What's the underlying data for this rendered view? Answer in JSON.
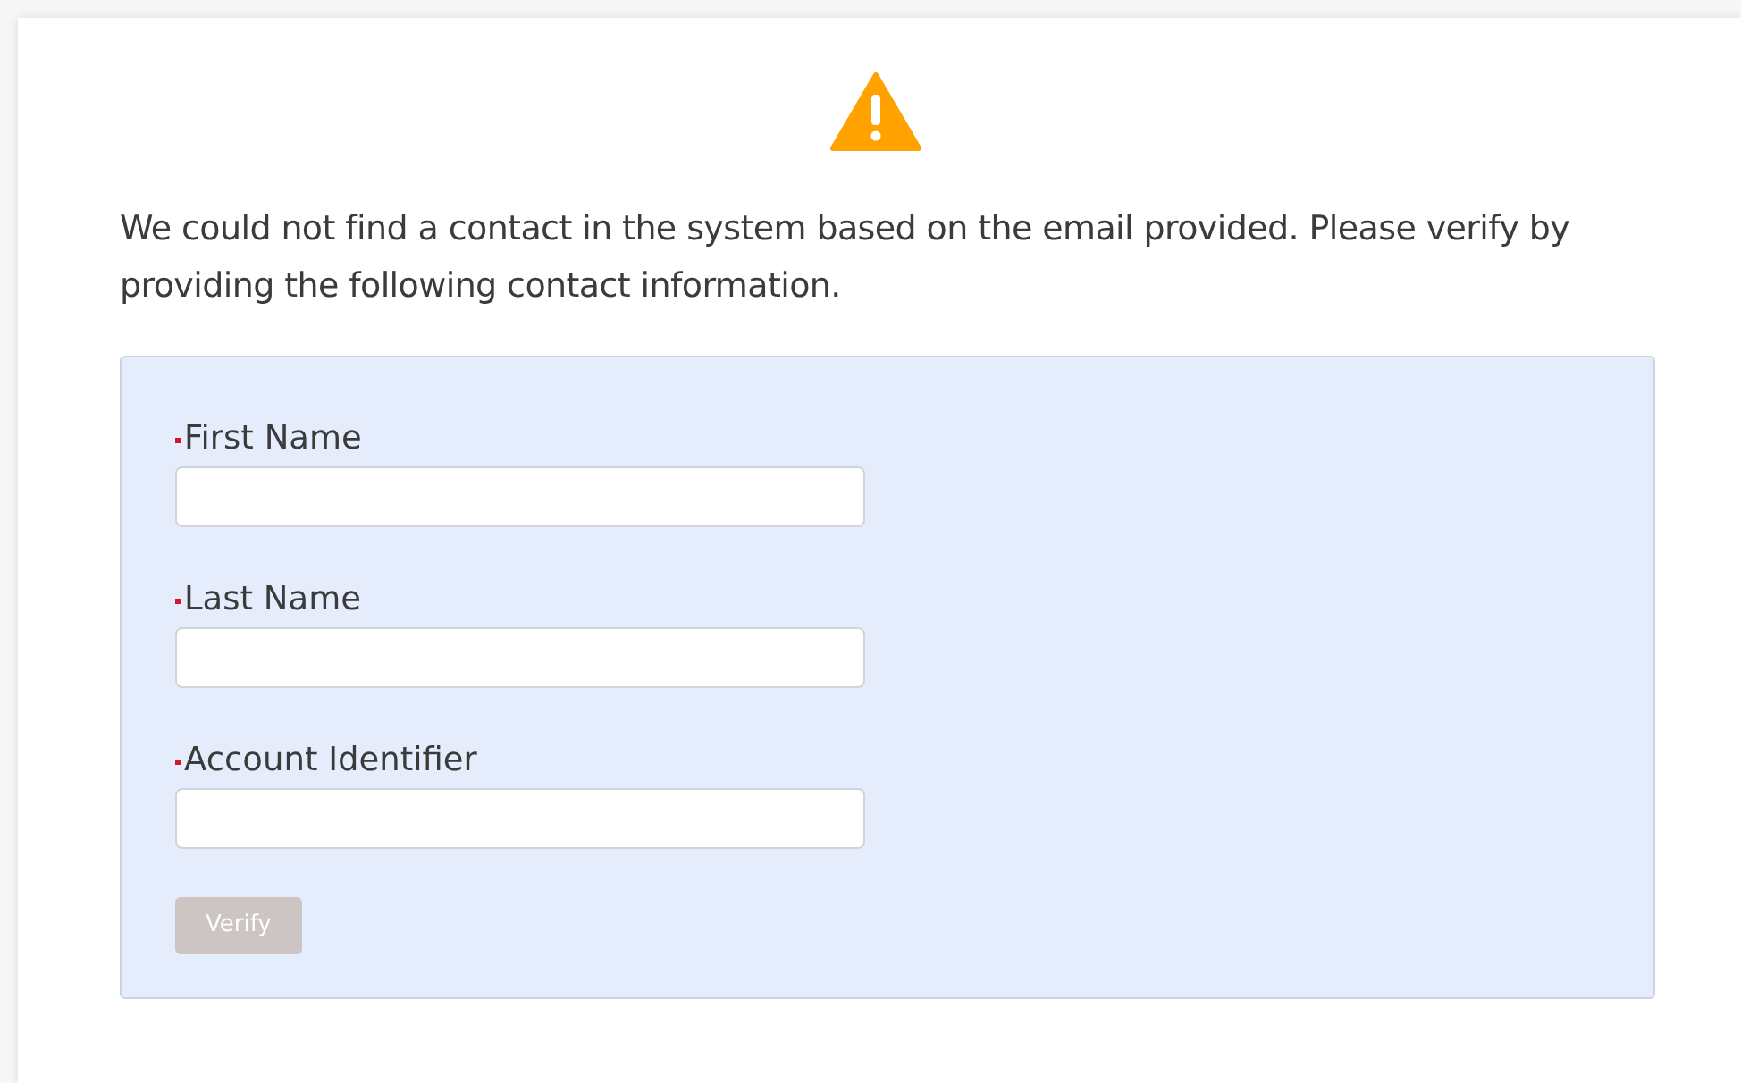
{
  "message": "We could not find a contact in the system based on the email provided. Please verify by providing the following contact information.",
  "fields": [
    {
      "label": "First Name",
      "required": true
    },
    {
      "label": "Last Name",
      "required": true
    },
    {
      "label": "Account Identifier",
      "required": true
    }
  ],
  "button": {
    "label": "Verify",
    "disabled": true
  }
}
